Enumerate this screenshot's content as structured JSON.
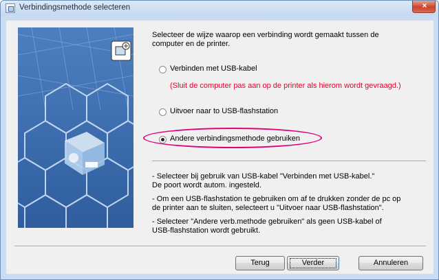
{
  "window": {
    "title": "Verbindingsmethode selecteren",
    "close_label": "×"
  },
  "intro": {
    "line1": "Selecteer de wijze waarop een verbinding wordt gemaakt tussen de",
    "line2": "computer en de printer."
  },
  "options": [
    {
      "label": "Verbinden met USB-kabel",
      "selected": false
    },
    {
      "label": "Uitvoer naar to USB-flashstation",
      "selected": false
    },
    {
      "label": "Andere verbindingsmethode gebruiken",
      "selected": true
    }
  ],
  "usb_warning": "(Sluit de computer pas aan op de printer als hierom wordt gevraagd.)",
  "info": {
    "usb_line1": "- Selecteer bij gebruik van USB-kabel \"Verbinden met USB-kabel.\"",
    "usb_line2": "De poort wordt autom. ingesteld.",
    "flash_line1": "- Om een USB-flashstation te gebruiken om af te drukken zonder de pc op",
    "flash_line2": "de printer aan te sluiten, selecteert u \"Uitvoer naar USB-flashstation\".",
    "other_line1": "- Selecteer \"Andere verb.methode gebruiken\" als geen USB-kabel of",
    "other_line2": "USB-flashstation wordt gebruikt."
  },
  "buttons": {
    "back": "Terug",
    "next": "Verder",
    "cancel": "Annuleren"
  },
  "colors": {
    "warning": "#e4002b",
    "highlight": "#e0007d",
    "banner": "#3e6fb0"
  }
}
